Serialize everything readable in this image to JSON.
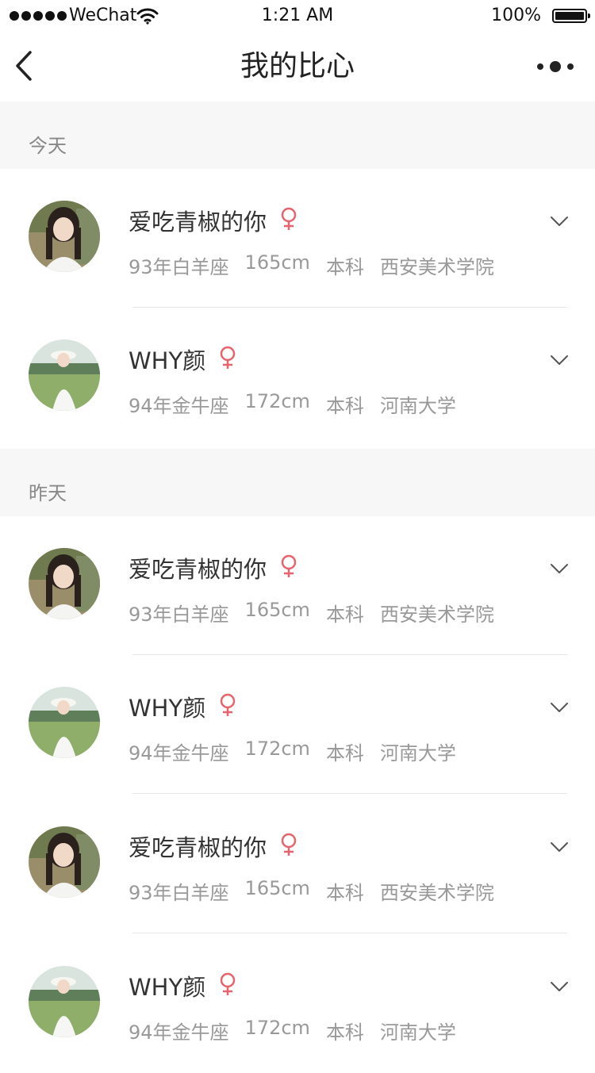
{
  "status_bar": {
    "carrier": "WeChat",
    "time": "1:21 AM",
    "battery": "100%",
    "battery_level": 1.0
  },
  "nav": {
    "title": "我的比心",
    "back_icon": "chevron-left-icon",
    "more_icon": "more-dots-icon"
  },
  "sections": [
    {
      "label": "今天",
      "items": [
        {
          "name": "爱吃青椒的你",
          "year_sign": "93年白羊座",
          "height": "165cm",
          "degree": "本科",
          "school": "西安美术学院",
          "gender_icon": "female-icon"
        },
        {
          "name": "WHY颜",
          "year_sign": "94年金牛座",
          "height": "172cm",
          "degree": "本科",
          "school": "河南大学",
          "gender_icon": "female-icon"
        }
      ]
    },
    {
      "label": "昨天",
      "items": [
        {
          "name": "爱吃青椒的你",
          "year_sign": "93年白羊座",
          "height": "165cm",
          "degree": "本科",
          "school": "西安美术学院",
          "gender_icon": "female-icon"
        },
        {
          "name": "WHY颜",
          "year_sign": "94年金牛座",
          "height": "172cm",
          "degree": "本科",
          "school": "河南大学",
          "gender_icon": "female-icon"
        },
        {
          "name": "爱吃青椒的你",
          "year_sign": "93年白羊座",
          "height": "165cm",
          "degree": "本科",
          "school": "西安美术学院",
          "gender_icon": "female-icon"
        },
        {
          "name": "WHY颜",
          "year_sign": "94年金牛座",
          "height": "172cm",
          "degree": "本科",
          "school": "河南大学",
          "gender_icon": "female-icon"
        }
      ]
    }
  ],
  "colors": {
    "gender_female": "#e8636b",
    "section_bg": "#f7f7f7",
    "text_primary": "#333333",
    "text_secondary": "#999999"
  }
}
